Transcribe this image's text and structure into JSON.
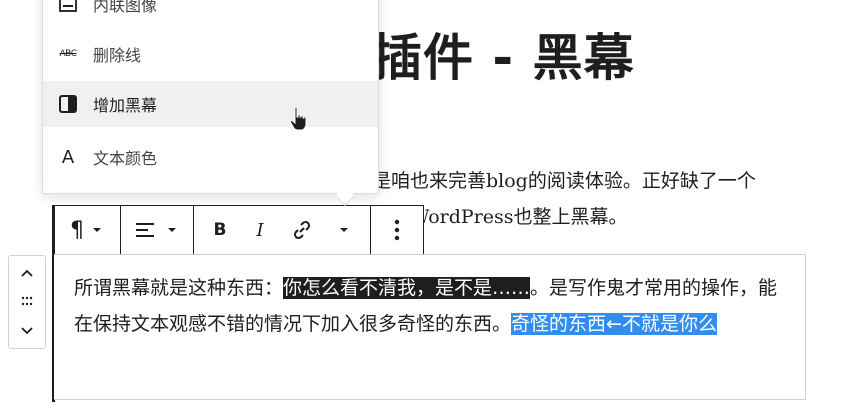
{
  "post": {
    "title_visible": "插件 - 黑幕",
    "bg_line1": "是咱也来完善blog的阅读体验。正好缺了一个",
    "bg_line2": "就给WordPress也整上黑幕。"
  },
  "editor": {
    "text_before": "所谓黑幕就是这种东西：",
    "blackout_text": "你怎么看不清我，是不是……",
    "text_middle": "。是写作鬼才常用的操作，能在保持文本观感不错的情况下加入很多奇怪的东西。",
    "selected_text_1": "奇怪的东西←不就",
    "selected_text_2": "是你么"
  },
  "menu": {
    "items": [
      {
        "label": "内联图像",
        "icon": "image-icon"
      },
      {
        "label": "删除线",
        "icon": "strikethrough-icon"
      },
      {
        "label": "增加黑幕",
        "icon": "blackout-icon",
        "active": true
      },
      {
        "label": "文本颜色",
        "icon": "text-color-icon"
      }
    ],
    "strike_icon_text": "ABC",
    "text_color_icon_text": "A"
  },
  "toolbar": {
    "paragraph_icon": "¶",
    "bold_icon": "B",
    "italic_icon": "I"
  },
  "colors": {
    "selection": "#338cf0",
    "blackout": "#1e1e1e",
    "menu_active_bg": "#f0f0f0"
  }
}
